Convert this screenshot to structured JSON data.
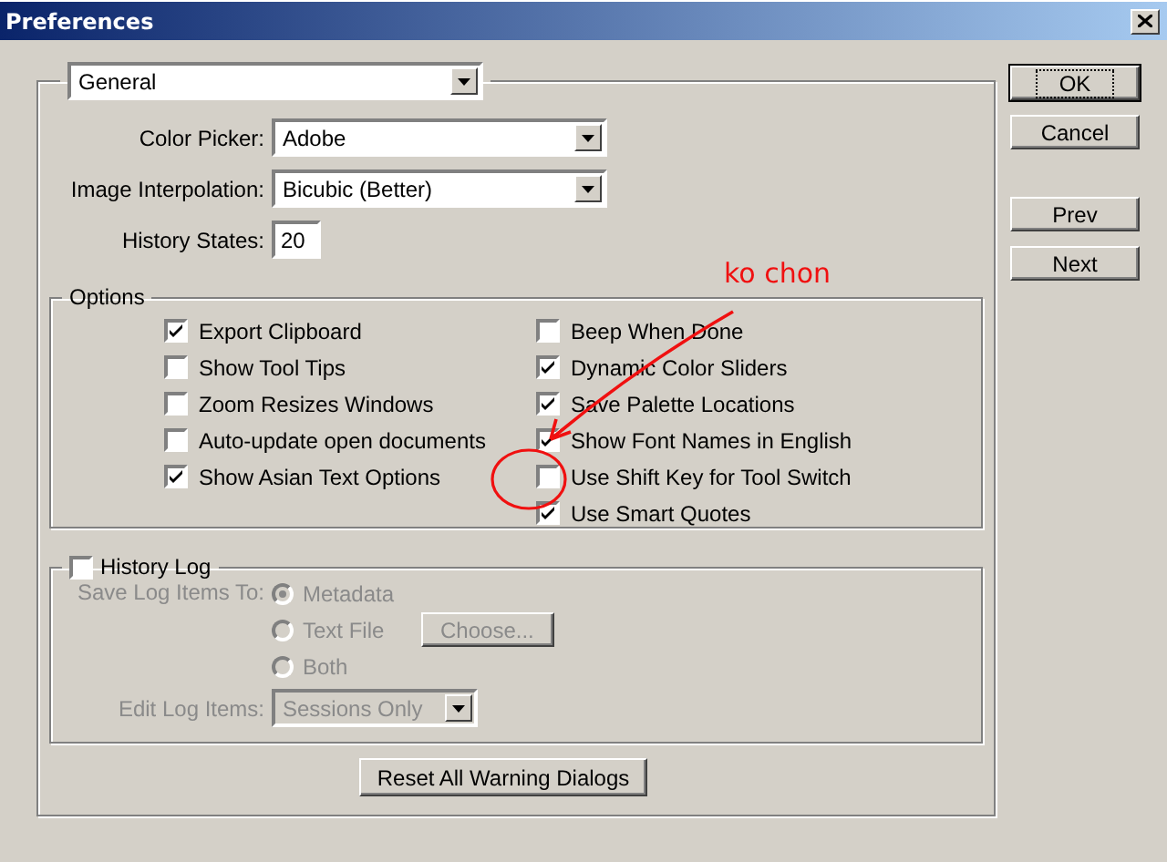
{
  "window": {
    "title": "Preferences"
  },
  "section_select": {
    "value": "General"
  },
  "fields": [
    {
      "kind": "dropdown",
      "label": "Color Picker:",
      "value": "Adobe"
    },
    {
      "kind": "dropdown",
      "label": "Image Interpolation:",
      "value": "Bicubic (Better)"
    },
    {
      "kind": "input",
      "label": "History States:",
      "value": "20"
    }
  ],
  "options": {
    "title": "Options",
    "columns": [
      [
        {
          "label": "Export Clipboard",
          "checked": true
        },
        {
          "label": "Show Tool Tips",
          "checked": false
        },
        {
          "label": "Zoom Resizes Windows",
          "checked": false
        },
        {
          "label": "Auto-update open documents",
          "checked": false
        },
        {
          "label": "Show Asian Text Options",
          "checked": true
        }
      ],
      [
        {
          "label": "Beep When Done",
          "checked": false
        },
        {
          "label": "Dynamic Color Sliders",
          "checked": true
        },
        {
          "label": "Save Palette Locations",
          "checked": true
        },
        {
          "label": "Show Font Names in English",
          "checked": true
        },
        {
          "label": "Use Shift Key for Tool Switch",
          "checked": false
        },
        {
          "label": "Use Smart Quotes",
          "checked": true
        }
      ]
    ]
  },
  "history_log": {
    "label": "History Log",
    "checked": false,
    "save_label": "Save Log Items To:",
    "radios": [
      {
        "label": "Metadata",
        "selected": true,
        "disabled": true
      },
      {
        "label": "Text File",
        "selected": false,
        "disabled": true
      },
      {
        "label": "Both",
        "selected": false,
        "disabled": true
      }
    ],
    "choose_button": {
      "label": "Choose...",
      "disabled": true
    },
    "edit_label": "Edit Log Items:",
    "edit_value": "Sessions Only",
    "disabled": true
  },
  "reset_button": {
    "label": "Reset All Warning Dialogs"
  },
  "buttons": {
    "primary": [
      {
        "label": "OK",
        "default": true
      },
      {
        "label": "Cancel",
        "default": false
      }
    ],
    "navigation": [
      {
        "label": "Prev",
        "default": false
      },
      {
        "label": "Next",
        "default": false
      }
    ]
  },
  "annotation": {
    "text": "ko chon"
  }
}
